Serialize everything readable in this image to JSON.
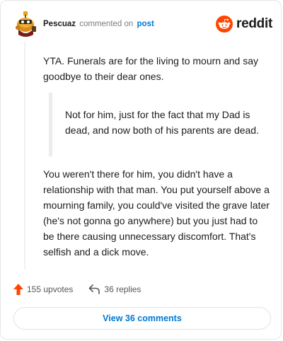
{
  "header": {
    "username": "Pescuaz",
    "action": "commented on",
    "post_link": "post",
    "brand": "reddit"
  },
  "comment": {
    "paragraph1": "YTA. Funerals are for the living to mourn and say goodbye to their dear ones.",
    "quote": "Not for him, just for the fact that my Dad is dead, and now both of his parents are dead.",
    "paragraph2": "You weren't there for him, you didn't have a relationship with that man. You put yourself above a mourning family, you could've visited the grave later (he's not gonna go anywhere) but you just had to be there causing unnecessary discomfort. That's selfish and a dick move."
  },
  "stats": {
    "upvotes": "155 upvotes",
    "replies": "36 replies"
  },
  "footer": {
    "view_comments": "View 36 comments"
  },
  "colors": {
    "reddit_orange": "#ff4500",
    "link_blue": "#0079d3",
    "upvote_orange": "#ff4500"
  },
  "icons": {
    "avatar": "snoo-avatar",
    "logo": "reddit-snoo-logo",
    "upvote": "upvote-arrow-icon",
    "reply": "reply-arrow-icon"
  }
}
